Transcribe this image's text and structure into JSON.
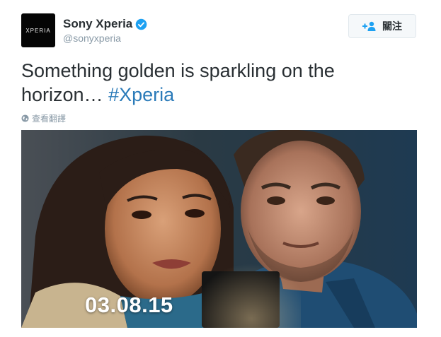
{
  "profile": {
    "avatar_text": "XPERIA",
    "display_name": "Sony Xperia",
    "handle": "@sonyxperia",
    "verified_icon": "verified-badge-icon"
  },
  "follow_button": {
    "label": "關注",
    "icon": "add-user-icon"
  },
  "tweet": {
    "text": "Something golden is sparkling on the horizon… ",
    "hashtag": "#Xperia"
  },
  "translate": {
    "label": "查看翻譯",
    "icon": "globe-icon"
  },
  "media": {
    "date_overlay": "03.08.15"
  },
  "colors": {
    "link": "#2b7bb9",
    "muted": "#8899a6",
    "verified": "#1da1f2"
  }
}
